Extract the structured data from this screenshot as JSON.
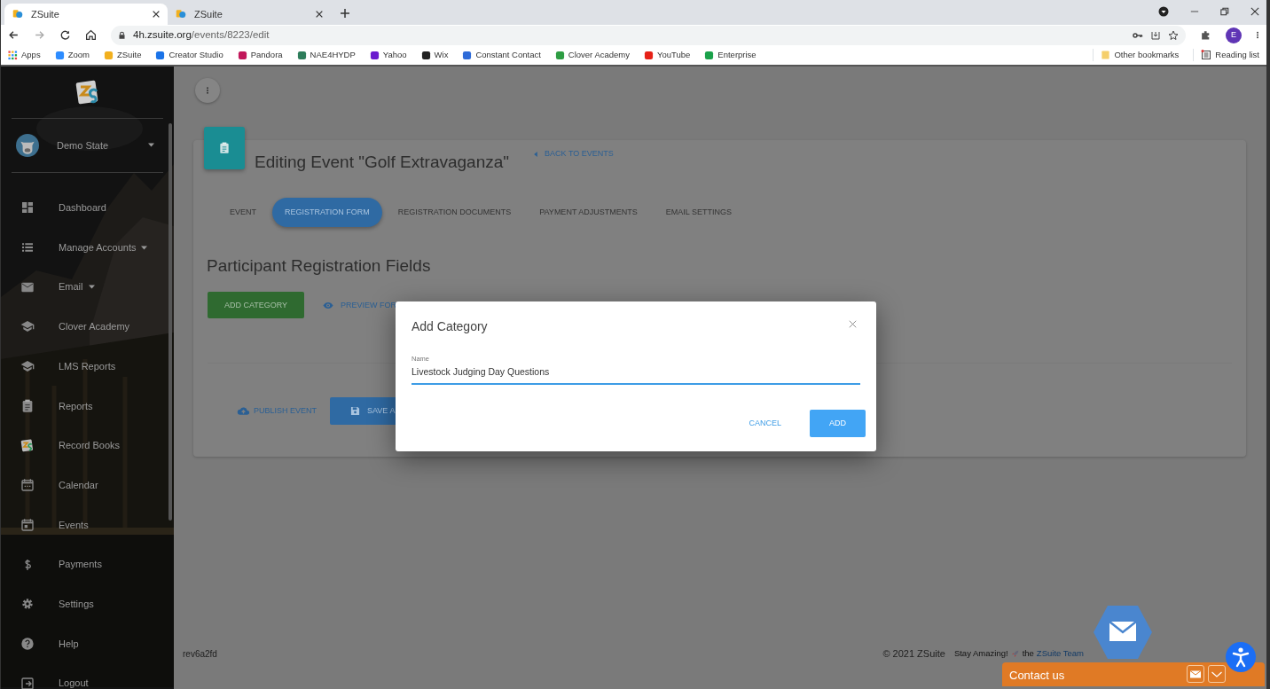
{
  "browser": {
    "tabs": [
      {
        "title": "ZSuite",
        "selected": true
      },
      {
        "title": "ZSuite",
        "selected": false
      }
    ],
    "url": {
      "host": "4h.zsuite.org",
      "path": "/events/8223/edit"
    },
    "bookmarks": [
      "Apps",
      "Zoom",
      "ZSuite",
      "Creator Studio",
      "Pandora",
      "NAE4HYDP",
      "Yahoo",
      "Wix",
      "Constant Contact",
      "Clover Academy",
      "YouTube",
      "Enterprise"
    ],
    "other_bookmarks": "Other bookmarks",
    "reading_list": "Reading list",
    "profile_initial": "E"
  },
  "sidebar": {
    "account": "Demo State",
    "items": [
      {
        "label": "Dashboard",
        "has_submenu": false
      },
      {
        "label": "Manage Accounts",
        "has_submenu": true
      },
      {
        "label": "Email",
        "has_submenu": true
      },
      {
        "label": "Clover Academy",
        "has_submenu": false
      },
      {
        "label": "LMS Reports",
        "has_submenu": false
      },
      {
        "label": "Reports",
        "has_submenu": false
      },
      {
        "label": "Record Books",
        "has_submenu": false
      },
      {
        "label": "Calendar",
        "has_submenu": false
      },
      {
        "label": "Events",
        "has_submenu": false
      },
      {
        "label": "Payments",
        "has_submenu": false
      },
      {
        "label": "Settings",
        "has_submenu": false
      },
      {
        "label": "Help",
        "has_submenu": false
      },
      {
        "label": "Logout",
        "has_submenu": false
      }
    ]
  },
  "page": {
    "title": "Editing Event \"Golf Extravaganza\"",
    "back_link": "BACK TO EVENTS",
    "tabs": [
      {
        "label": "EVENT",
        "selected": false
      },
      {
        "label": "REGISTRATION FORM",
        "selected": true
      },
      {
        "label": "REGISTRATION DOCUMENTS",
        "selected": false
      },
      {
        "label": "PAYMENT ADJUSTMENTS",
        "selected": false
      },
      {
        "label": "EMAIL SETTINGS",
        "selected": false
      }
    ],
    "section_title": "Participant Registration Fields",
    "add_category": "ADD CATEGORY",
    "preview_form": "PREVIEW FOR",
    "publish": "PUBLISH EVENT",
    "save": "SAVE A"
  },
  "footer": {
    "version": "rev6a2fd",
    "copyright": "© 2021 ZSuite",
    "tagline": "Stay Amazing!",
    "by": "the",
    "team_link": "ZSuite Team"
  },
  "modal": {
    "title": "Add Category",
    "field_label": "Name",
    "field_value": "Livestock Judging Day Questions",
    "cancel": "CANCEL",
    "add": "ADD"
  },
  "contact": {
    "label": "Contact us"
  }
}
